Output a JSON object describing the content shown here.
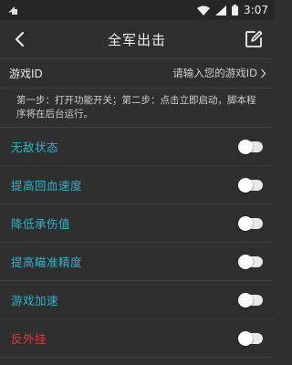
{
  "status_bar": {
    "time": "3:07",
    "icons": [
      "notification-arrow-icon",
      "wifi-icon",
      "signal-icon",
      "battery-icon"
    ]
  },
  "header": {
    "title": "全军出击",
    "back_icon": "chevron-left-icon",
    "edit_icon": "edit-icon"
  },
  "game_id": {
    "label": "游戏ID",
    "placeholder": "请输入您的游戏ID",
    "value": ""
  },
  "instructions": "第一步：打开功能开关；第二步：点击立即启动，脚本程序将在后台运行。",
  "features": [
    {
      "label": "无敌状态",
      "color": "#2fb3c9",
      "enabled": false
    },
    {
      "label": "提高回血速度",
      "color": "#2fb3c9",
      "enabled": false
    },
    {
      "label": "降低承伤值",
      "color": "#2fb3c9",
      "enabled": false
    },
    {
      "label": "提高瞄准精度",
      "color": "#2fb3c9",
      "enabled": false
    },
    {
      "label": "游戏加速",
      "color": "#2fb3c9",
      "enabled": false
    },
    {
      "label": "反外挂",
      "color": "#e23b3b",
      "enabled": false
    }
  ],
  "colors": {
    "background": "#2f2f30",
    "accent": "#2fb3c9",
    "warning": "#e23b3b"
  }
}
